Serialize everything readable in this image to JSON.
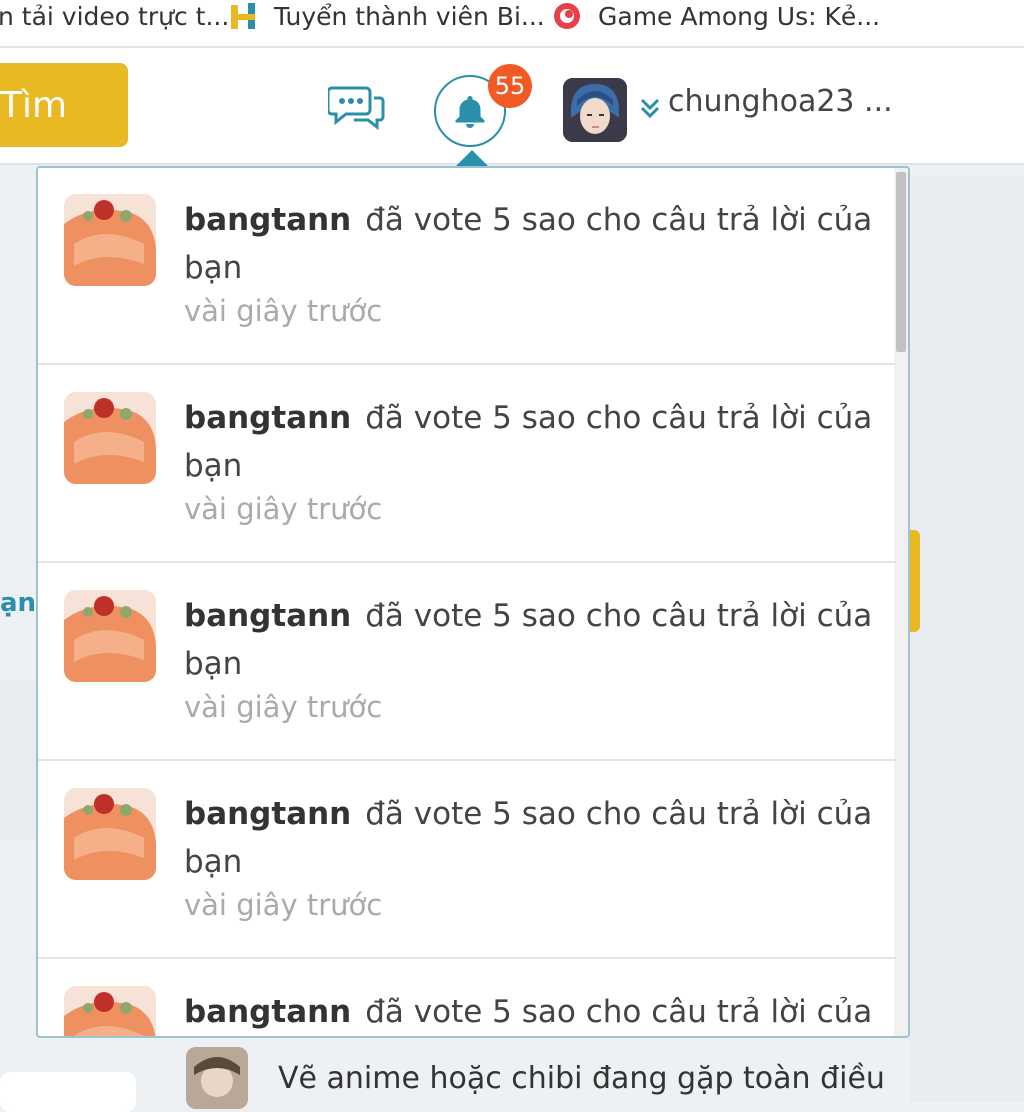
{
  "bookmarks": [
    {
      "label": "n tải video trực t...",
      "icon": "page-icon"
    },
    {
      "label": "Tuyển thành viên Bi...",
      "icon": "h-logo-icon"
    },
    {
      "label": "Game Among Us: Kẻ...",
      "icon": "game-logo-icon"
    }
  ],
  "header": {
    "search_label": "Tìm",
    "notification_count": "55",
    "username": "chunghoa23 ...",
    "colors": {
      "accent": "#2a8fa8",
      "search": "#e8b923",
      "badge": "#f05a24"
    }
  },
  "notifications": {
    "items": [
      {
        "user": "bangtann",
        "text": "đã vote 5 sao cho câu trả lời của bạn",
        "time": "vài giây trước"
      },
      {
        "user": "bangtann",
        "text": "đã vote 5 sao cho câu trả lời của bạn",
        "time": "vài giây trước"
      },
      {
        "user": "bangtann",
        "text": "đã vote 5 sao cho câu trả lời của bạn",
        "time": "vài giây trước"
      },
      {
        "user": "bangtann",
        "text": "đã vote 5 sao cho câu trả lời của bạn",
        "time": "vài giây trước"
      },
      {
        "user": "bangtann",
        "text": "đã vote 5 sao cho câu trả lời của",
        "time": ""
      }
    ]
  },
  "background": {
    "left_fragment": "ạn",
    "bottom_post": "Vẽ anime hoặc chibi đang gặp toàn điều"
  }
}
